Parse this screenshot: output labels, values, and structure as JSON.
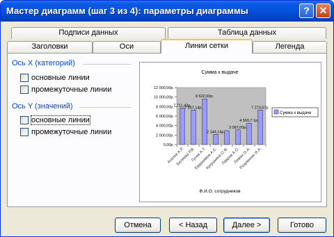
{
  "window": {
    "title": "Мастер диаграмм (шаг 3 из 4): параметры диаграммы",
    "help_glyph": "?",
    "close_glyph": "✕"
  },
  "tabs_row_back": [
    {
      "label": "Подписи данных"
    },
    {
      "label": "Таблица данных"
    }
  ],
  "tabs_row_front": [
    {
      "label": "Заголовки"
    },
    {
      "label": "Оси"
    },
    {
      "label": "Линии сетки",
      "active": true
    },
    {
      "label": "Легенда"
    }
  ],
  "group_x": {
    "label": "Ось X (категорий)",
    "major": {
      "label": "основные линии",
      "checked": false
    },
    "minor": {
      "label": "промежуточные линии",
      "checked": false
    }
  },
  "group_y": {
    "label": "Ось Y (значений)",
    "major": {
      "label": "основные линии",
      "checked": false
    },
    "minor": {
      "label": "промежуточные линии",
      "checked": false
    }
  },
  "buttons": {
    "cancel": "Отмена",
    "back": "< Назад",
    "next": "Далее >",
    "finish": "Готово"
  },
  "colors": {
    "bar": "#9999ff",
    "plot_area": "#c0c0c0",
    "group_label": "#0046d5"
  },
  "chart_data": {
    "type": "bar",
    "title": "Сумма к выдаче",
    "xlabel": "Ф.И.О. сотрудников",
    "ylabel": "",
    "legend": "Сумма к выдаче",
    "legend_position": "right",
    "ylim": [
      0,
      12000
    ],
    "yticks": [
      0,
      2000,
      4000,
      6000,
      8000,
      10000,
      12000
    ],
    "ytick_labels": [
      "0,00р.",
      "2 000,00р.",
      "4 000,00р.",
      "6 000,00р.",
      "8 000,00р.",
      "10 000,00р.",
      "12 000,00р."
    ],
    "categories": [
      "Агапов А.Р.",
      "Беляева Р.В.",
      "Гусев А.Т.",
      "Евдокимов А.С.",
      "Кукушкина О.Ф.",
      "Лавров А.О.",
      "Лемин О.А.",
      "Разумихин И.А."
    ],
    "values": [
      7711.43,
      7267.14,
      9622.0,
      2144.14,
      2930,
      3097.0,
      4500.7,
      7273.57
    ],
    "data_labels": [
      "7 711,43р.",
      "7 267,14р.",
      "9 622,00р.",
      "2 144,14р.",
      "",
      "3 097,00р.",
      "4 500,7 1р.",
      "7 273,57р."
    ]
  }
}
